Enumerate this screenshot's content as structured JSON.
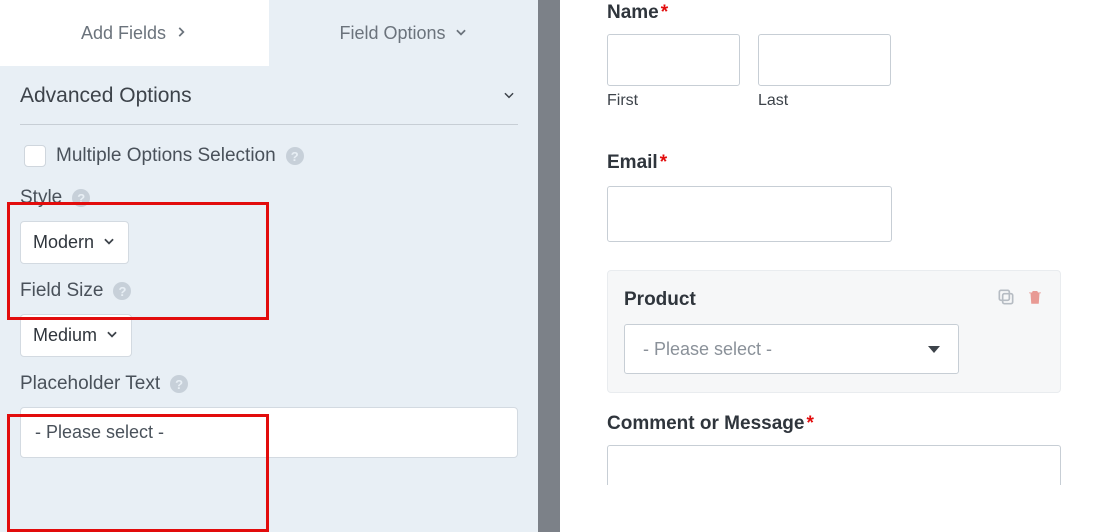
{
  "tabs": {
    "add_fields": "Add Fields",
    "field_options": "Field Options"
  },
  "section": {
    "title": "Advanced Options"
  },
  "options": {
    "multiple_selection": "Multiple Options Selection"
  },
  "style": {
    "label": "Style",
    "value": "Modern"
  },
  "field_size": {
    "label": "Field Size",
    "value": "Medium"
  },
  "placeholder_text": {
    "label": "Placeholder Text",
    "value": "- Please select -"
  },
  "preview": {
    "name": {
      "label": "Name",
      "first": "First",
      "last": "Last"
    },
    "email": {
      "label": "Email"
    },
    "product": {
      "label": "Product",
      "placeholder": "- Please select -"
    },
    "comment": {
      "label": "Comment or Message"
    }
  }
}
